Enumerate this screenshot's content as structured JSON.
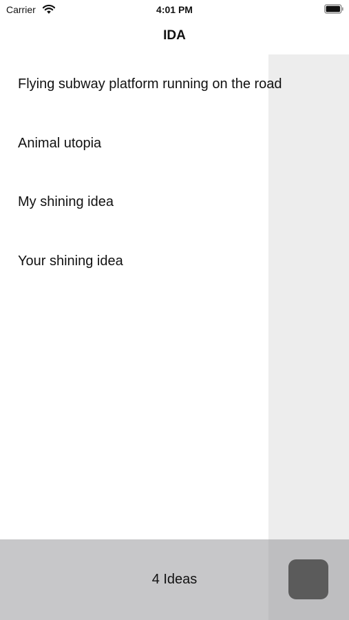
{
  "status_bar": {
    "carrier": "Carrier",
    "time": "4:01 PM",
    "wifi_icon": "wifi-icon",
    "battery_icon": "battery-full-icon"
  },
  "nav": {
    "title": "IDA"
  },
  "ideas": [
    {
      "title": "Flying subway platform running on the road"
    },
    {
      "title": "Animal utopia"
    },
    {
      "title": "My shining idea"
    },
    {
      "title": "Your shining idea"
    }
  ],
  "toolbar": {
    "count_label": "4 Ideas",
    "action_button_color": "#5b5b5b",
    "background_color": "#c7c7c9"
  },
  "colors": {
    "side_panel": "#ededed",
    "background": "#ffffff"
  }
}
